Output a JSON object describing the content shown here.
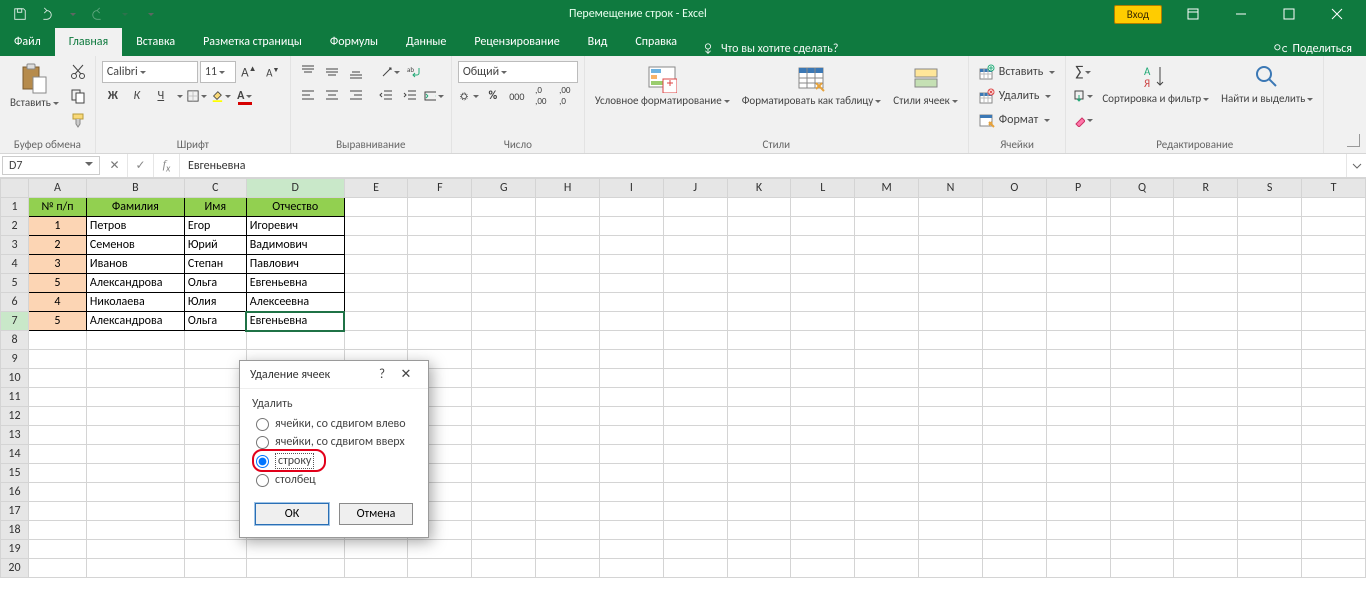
{
  "title": "Перемещение строк  -  Excel",
  "login": "Вход",
  "tabs": [
    "Файл",
    "Главная",
    "Вставка",
    "Разметка страницы",
    "Формулы",
    "Данные",
    "Рецензирование",
    "Вид",
    "Справка"
  ],
  "tellme": "Что вы хотите сделать?",
  "share": "Поделиться",
  "ribbon": {
    "clipboard": {
      "paste": "Вставить",
      "label": "Буфер обмена"
    },
    "font": {
      "name": "Calibri",
      "size": "11",
      "label": "Шрифт"
    },
    "alignment": {
      "label": "Выравнивание"
    },
    "number": {
      "format": "Общий",
      "label": "Число"
    },
    "styles": {
      "cond": "Условное форматирование",
      "table": "Форматировать как таблицу",
      "cell": "Стили ячеек",
      "label": "Стили"
    },
    "cells": {
      "insert": "Вставить",
      "delete": "Удалить",
      "format": "Формат",
      "label": "Ячейки"
    },
    "editing": {
      "sort": "Сортировка и фильтр",
      "find": "Найти и выделить",
      "label": "Редактирование"
    }
  },
  "namebox": "D7",
  "formula": "Евгеньевна",
  "columns": [
    "A",
    "B",
    "C",
    "D",
    "E",
    "F",
    "G",
    "H",
    "I",
    "J",
    "K",
    "L",
    "M",
    "N",
    "O",
    "P",
    "Q",
    "R",
    "S",
    "T"
  ],
  "headers": [
    "№ п/п",
    "Фамилия",
    "Имя",
    "Отчество"
  ],
  "rows": [
    {
      "n": "1",
      "f": "Петров",
      "i": "Егор",
      "o": "Игоревич"
    },
    {
      "n": "2",
      "f": "Семенов",
      "i": "Юрий",
      "o": "Вадимович"
    },
    {
      "n": "3",
      "f": "Иванов",
      "i": "Степан",
      "o": "Павлович"
    },
    {
      "n": "5",
      "f": "Александрова",
      "i": "Ольга",
      "o": "Евгеньевна"
    },
    {
      "n": "4",
      "f": "Николаева",
      "i": "Юлия",
      "o": "Алексеевна"
    },
    {
      "n": "5",
      "f": "Александрова",
      "i": "Ольга",
      "o": "Евгеньевна"
    }
  ],
  "dialog": {
    "title": "Удаление ячеек",
    "section": "Удалить",
    "opts": [
      "ячейки, со сдвигом влево",
      "ячейки, со сдвигом вверх",
      "строку",
      "столбец"
    ],
    "ok": "ОК",
    "cancel": "Отмена"
  }
}
